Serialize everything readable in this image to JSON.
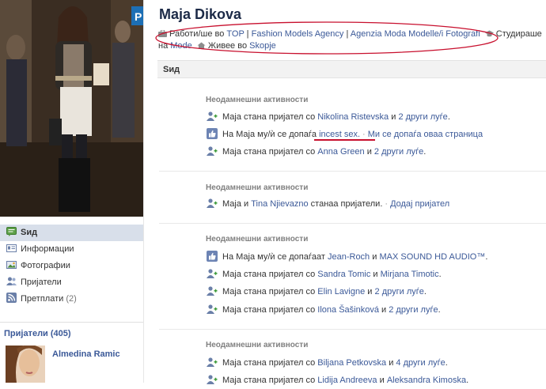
{
  "profile": {
    "name": "Maja Dikova",
    "info": {
      "work_prefix": "Работи/ше во",
      "workplaces": [
        "TOP",
        "Fashion Models Agency",
        "Agenzia Moda Modelle/i Fotografi"
      ],
      "study_prefix": "Студираше на",
      "school": "Mode",
      "live_prefix": "Живее во",
      "city": "Skopje"
    }
  },
  "nav": {
    "items": [
      {
        "label": "Ѕид",
        "icon": "wall-icon",
        "active": true
      },
      {
        "label": "Информации",
        "icon": "info-icon",
        "active": false
      },
      {
        "label": "Фотографии",
        "icon": "photos-icon",
        "active": false
      },
      {
        "label": "Пријатели",
        "icon": "friends-icon",
        "active": false
      },
      {
        "label": "Претплати",
        "icon": "rss-icon",
        "count": "(2)",
        "active": false
      }
    ]
  },
  "friends": {
    "title": "Пријатели (405)",
    "first": "Almedina Ramic"
  },
  "wall": {
    "title": "Ѕид",
    "section_title": "Неодамнешни активности",
    "sections": [
      {
        "stories": [
          {
            "type": "friend",
            "pre": "Маја стана пријател со",
            "l1": "Nikolina Ristevska",
            "mid": "и",
            "l2": "2 други луѓе",
            "post": "."
          },
          {
            "type": "like",
            "pre": "На Маја му/ѝ се допаѓа",
            "l1": "incest sex.",
            "sep": "·",
            "l2": "Ми се допаѓа оваа страница"
          },
          {
            "type": "friend",
            "pre": "Маја стана пријател со",
            "l1": "Anna Green",
            "mid": "и",
            "l2": "2 други луѓе",
            "post": "."
          }
        ]
      },
      {
        "stories": [
          {
            "type": "friend",
            "pre": "Маја и",
            "l1": "Tina Njievazno",
            "mid": "станаа пријатели.",
            "sep": "·",
            "l2": "Додај пријател"
          }
        ]
      },
      {
        "stories": [
          {
            "type": "like",
            "pre": "На Маја му/ѝ се допаѓаат",
            "l1": "Jean-Roch",
            "mid": "и",
            "l2": "MAX SOUND HD AUDIO™",
            "post": "."
          },
          {
            "type": "friend",
            "pre": "Маја стана пријател со",
            "l1": "Sandra Tomic",
            "mid": "и",
            "l2": "Mirjana Timotic",
            "post": "."
          },
          {
            "type": "friend",
            "pre": "Маја стана пријател со",
            "l1": "Elin Lavigne",
            "mid": "и",
            "l2": "2 други луѓе",
            "post": "."
          },
          {
            "type": "friend",
            "pre": "Маја стана пријател со",
            "l1": "Ilona Šašinková",
            "mid": "и",
            "l2": "2 други луѓе",
            "post": "."
          }
        ]
      },
      {
        "stories": [
          {
            "type": "friend",
            "pre": "Маја стана пријател со",
            "l1": "Biljana Petkovska",
            "mid": "и",
            "l2": "4 други луѓе",
            "post": "."
          },
          {
            "type": "friend",
            "pre": "Маја стана пријател со",
            "l1": "Lidija Andreeva",
            "mid": "и",
            "l2": "Aleksandra Kimoska",
            "post": "."
          }
        ]
      }
    ]
  },
  "colors": {
    "link": "#3b5998",
    "annotation_red": "#c8102e",
    "nav_active_bg": "#d8dfea"
  }
}
